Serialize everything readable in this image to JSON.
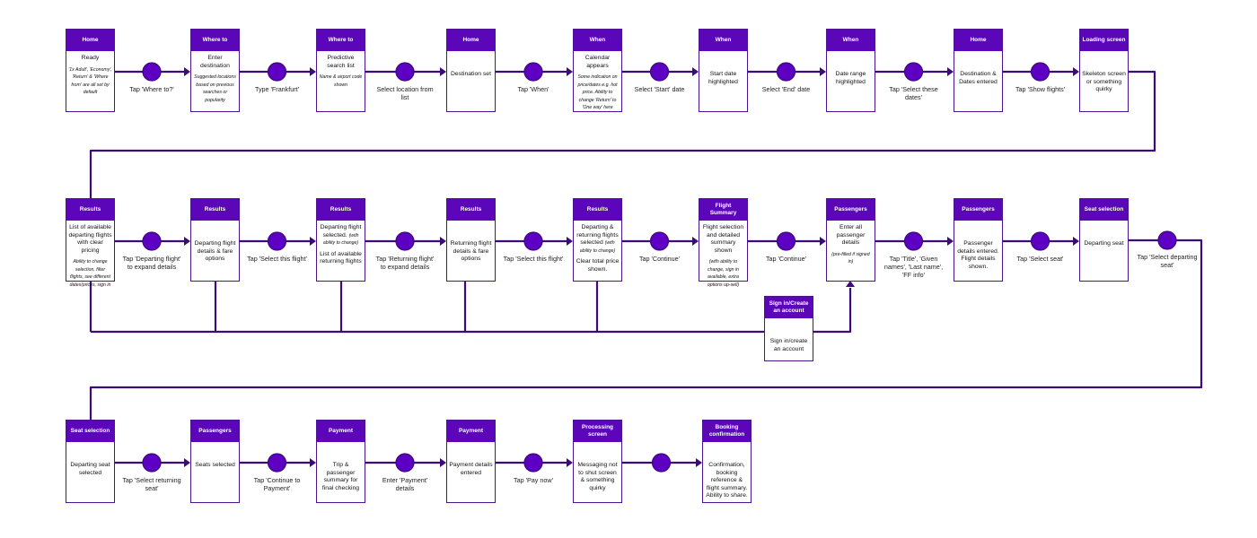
{
  "colors": {
    "header": "#5b06b8",
    "line": "#3b0b78",
    "circle": "#5e00c4"
  },
  "rows": [
    {
      "cards": [
        {
          "title": "Home",
          "body": [
            [
              {
                "t": "Ready"
              }
            ],
            [
              {
                "t": "'1x Adult', 'Economy', 'Return' & 'Where from' are all set by default",
                "i": true
              }
            ]
          ]
        },
        {
          "title": "Where to",
          "body": [
            [
              {
                "t": "Enter destination"
              }
            ],
            [
              {
                "t": "Suggested locations based on previous searches or popularity",
                "i": true
              }
            ]
          ]
        },
        {
          "title": "Where to",
          "body": [
            [
              {
                "t": "Predictive search list"
              }
            ],
            [
              {
                "t": "Name & airport code shown",
                "i": true
              }
            ]
          ]
        },
        {
          "title": "Home",
          "body": [
            [
              {
                "t": "Destination set"
              }
            ]
          ]
        },
        {
          "title": "When",
          "body": [
            [
              {
                "t": "Calendar appears"
              }
            ],
            [
              {
                "t": "Some indication on price/dates e.g. hot price. Ability to change 'Return' to 'One way' here",
                "i": true
              }
            ]
          ]
        },
        {
          "title": "When",
          "body": [
            [
              {
                "t": "Start date highlighted"
              }
            ]
          ]
        },
        {
          "title": "When",
          "body": [
            [
              {
                "t": "Date range highlighted"
              }
            ]
          ]
        },
        {
          "title": "Home",
          "body": [
            [
              {
                "t": "Destination & Dates entered"
              }
            ]
          ]
        },
        {
          "title": "Loading screen",
          "body": [
            [
              {
                "t": "Skeleton screen or something quirky"
              }
            ]
          ]
        }
      ],
      "steps": [
        "Tap 'Where to?'",
        "Type 'Frankfurt'",
        "Select location from list",
        "Tap 'When'",
        "Select 'Start' date",
        "Select 'End' date",
        "Tap 'Select these dates'",
        "Tap 'Show flights'"
      ]
    },
    {
      "cards": [
        {
          "title": "Results",
          "body": [
            [
              {
                "t": "List of available departing flights with clear pricing"
              }
            ],
            [
              {
                "t": "Ability to change selection, filter flights, see different dates/prices, sign in",
                "i": true
              }
            ]
          ]
        },
        {
          "title": "Results",
          "body": [
            [
              {
                "t": "Departing flight details & fare options"
              }
            ]
          ]
        },
        {
          "title": "Results",
          "body": [
            [
              {
                "t": "Departing flight selected. "
              },
              {
                "t": "(with ability to change)",
                "i": true
              }
            ],
            [
              {
                "t": "List of available returning flights"
              }
            ]
          ]
        },
        {
          "title": "Results",
          "body": [
            [
              {
                "t": "Returning flight details & fare options"
              }
            ]
          ]
        },
        {
          "title": "Results",
          "body": [
            [
              {
                "t": "Departing & returning flights selected "
              },
              {
                "t": "(with ability to change)",
                "i": true
              }
            ],
            [
              {
                "t": "Clear total price shown."
              }
            ]
          ]
        },
        {
          "title": "Flight Summary",
          "body": [
            [
              {
                "t": "Flight selection and detailed summary shown"
              }
            ],
            [
              {
                "t": "(with ability to change, sign in available, extra options up-sell)",
                "i": true
              }
            ]
          ]
        },
        {
          "title": "Passengers",
          "body": [
            [
              {
                "t": "Enter all passenger details"
              }
            ],
            [
              {
                "t": "(pre-filled if signed in)",
                "i": true
              }
            ]
          ]
        },
        {
          "title": "Passengers",
          "body": [
            [
              {
                "t": "Passenger details entered. Flight details shown."
              }
            ]
          ]
        },
        {
          "title": "Seat selection",
          "body": [
            [
              {
                "t": "Departing seat"
              }
            ]
          ]
        }
      ],
      "steps": [
        "Tap 'Departing flight' to expand details",
        "Tap 'Select this flight'",
        "Tap 'Returning flight' to expand details",
        "Tap 'Select this flight'",
        "Tap 'Continue'",
        "Tap 'Continue'",
        "Tap 'Title', 'Given names', 'Last name', 'FF info'",
        "Tap 'Select seat'"
      ],
      "wrap_step": "Tap 'Select departing seat'"
    },
    {
      "cards": [
        {
          "title": "Seat selection",
          "body": [
            [
              {
                "t": "Departing seat selected"
              }
            ]
          ]
        },
        {
          "title": "Passengers",
          "body": [
            [
              {
                "t": "Seats selected"
              }
            ]
          ]
        },
        {
          "title": "Payment",
          "body": [
            [
              {
                "t": "Trip & passenger summary for final checking"
              }
            ]
          ]
        },
        {
          "title": "Payment",
          "body": [
            [
              {
                "t": "Payment details entered"
              }
            ]
          ]
        },
        {
          "title": "Processing screen",
          "body": [
            [
              {
                "t": "Messaging not to shut screen & something quirky"
              }
            ]
          ]
        },
        {
          "title": "Booking confirmation",
          "body": [
            [
              {
                "t": "Confirmation, booking reference & flight summary. Ability to share."
              }
            ]
          ]
        }
      ],
      "steps": [
        "Tap 'Select returning seat'",
        "Tap 'Continue to Payment'",
        "Enter 'Payment' details",
        "Tap 'Pay now'",
        ""
      ]
    }
  ],
  "signin": {
    "title": "Sign in/Create an account",
    "body": [
      [
        {
          "t": "Sign in/create an account"
        }
      ]
    ]
  }
}
